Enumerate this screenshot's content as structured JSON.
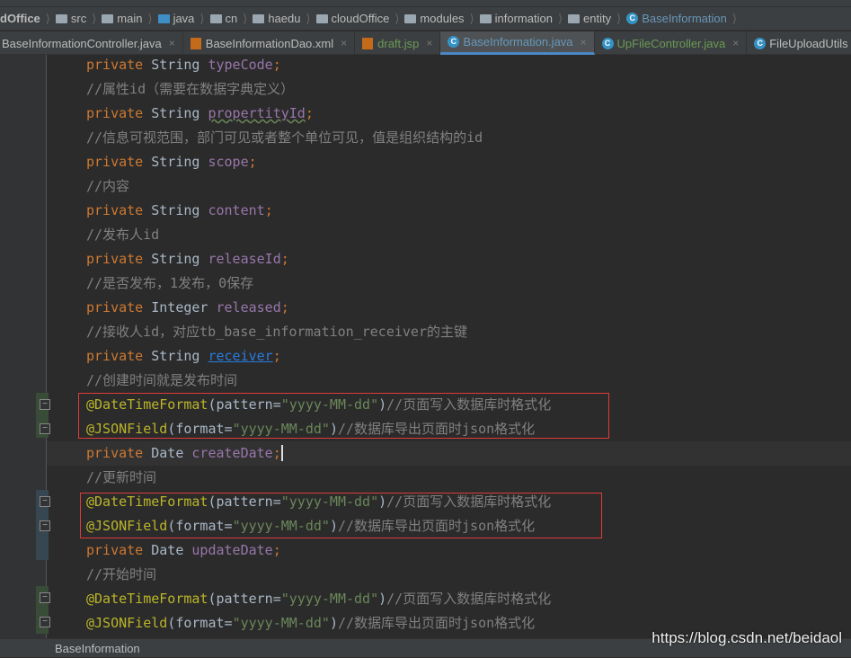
{
  "breadcrumb": [
    {
      "label": "dOffice",
      "icon": "none"
    },
    {
      "label": "src",
      "icon": "folder"
    },
    {
      "label": "main",
      "icon": "folder"
    },
    {
      "label": "java",
      "icon": "folder-blue"
    },
    {
      "label": "cn",
      "icon": "package"
    },
    {
      "label": "haedu",
      "icon": "package"
    },
    {
      "label": "cloudOffice",
      "icon": "package"
    },
    {
      "label": "modules",
      "icon": "package"
    },
    {
      "label": "information",
      "icon": "package"
    },
    {
      "label": "entity",
      "icon": "package"
    },
    {
      "label": "BaseInformation",
      "icon": "class"
    }
  ],
  "tabs": [
    {
      "label": "BaseInformationController.java",
      "icon": "none",
      "color": "#bbbbbb"
    },
    {
      "label": "BaseInformationDao.xml",
      "icon": "xml",
      "color": "#bbbbbb"
    },
    {
      "label": "draft.jsp",
      "icon": "jsp",
      "color": "#6a9955"
    },
    {
      "label": "BaseInformation.java",
      "icon": "class",
      "active": true,
      "color": "#6897bb"
    },
    {
      "label": "UpFileController.java",
      "icon": "class",
      "color": "#6a9955"
    },
    {
      "label": "FileUploadUtils",
      "icon": "class",
      "color": "#bbbbbb"
    }
  ],
  "code": [
    [
      [
        "kw",
        "private "
      ],
      [
        "ty",
        "String "
      ],
      [
        "fd",
        "typeCode"
      ],
      [
        "kw",
        ";"
      ]
    ],
    [
      [
        "cm",
        "//属性id（需要在数据字典定义）"
      ]
    ],
    [
      [
        "kw",
        "private "
      ],
      [
        "ty",
        "String "
      ],
      [
        "fd wavy",
        "propertityId"
      ],
      [
        "kw",
        ";"
      ]
    ],
    [
      [
        "cm",
        "//信息可视范围，部门可见或者整个单位可见，值是组织结构的id"
      ]
    ],
    [
      [
        "kw",
        "private "
      ],
      [
        "ty",
        "String "
      ],
      [
        "fd",
        "scope"
      ],
      [
        "kw",
        ";"
      ]
    ],
    [
      [
        "cm",
        "//内容"
      ]
    ],
    [
      [
        "kw",
        "private "
      ],
      [
        "ty",
        "String "
      ],
      [
        "fd",
        "content"
      ],
      [
        "kw",
        ";"
      ]
    ],
    [
      [
        "cm",
        "//发布人id"
      ]
    ],
    [
      [
        "kw",
        "private "
      ],
      [
        "ty",
        "String "
      ],
      [
        "fd",
        "releaseId"
      ],
      [
        "kw",
        ";"
      ]
    ],
    [
      [
        "cm",
        "//是否发布，1发布，0保存"
      ]
    ],
    [
      [
        "kw",
        "private "
      ],
      [
        "ty",
        "Integer "
      ],
      [
        "fd",
        "released"
      ],
      [
        "kw",
        ";"
      ]
    ],
    [
      [
        "cm",
        "//接收人id，对应tb_base_information_receiver的主键"
      ]
    ],
    [
      [
        "kw",
        "private "
      ],
      [
        "ty",
        "String "
      ],
      [
        "fd link",
        "receiver"
      ],
      [
        "kw",
        ";"
      ]
    ],
    [
      [
        "cm",
        "//创建时间就是发布时间"
      ]
    ],
    [
      [
        "an",
        "@DateTimeFormat"
      ],
      [
        "pl",
        "(pattern="
      ],
      [
        "st",
        "\"yyyy-MM-dd\""
      ],
      [
        "pl",
        ")"
      ],
      [
        "cm",
        "//页面写入数据库时格式化"
      ]
    ],
    [
      [
        "an",
        "@JSONField"
      ],
      [
        "pl",
        "(format="
      ],
      [
        "st",
        "\"yyyy-MM-dd\""
      ],
      [
        "pl",
        ")"
      ],
      [
        "cm",
        "//数据库导出页面时json格式化"
      ]
    ],
    [
      [
        "kw",
        "private "
      ],
      [
        "ty",
        "Date "
      ],
      [
        "fd",
        "createDate"
      ],
      [
        "kw caret",
        ";"
      ]
    ],
    [
      [
        "cm",
        "//更新时间"
      ]
    ],
    [
      [
        "an",
        "@DateTimeFormat"
      ],
      [
        "pl",
        "(pattern="
      ],
      [
        "st",
        "\"yyyy-MM-dd\""
      ],
      [
        "pl",
        ")"
      ],
      [
        "cm",
        "//页面写入数据库时格式化"
      ]
    ],
    [
      [
        "an",
        "@JSONField"
      ],
      [
        "pl",
        "(format="
      ],
      [
        "st",
        "\"yyyy-MM-dd\""
      ],
      [
        "pl",
        ")"
      ],
      [
        "cm",
        "//数据库导出页面时json格式化"
      ]
    ],
    [
      [
        "kw",
        "private "
      ],
      [
        "ty",
        "Date "
      ],
      [
        "fd",
        "updateDate"
      ],
      [
        "kw",
        ";"
      ]
    ],
    [
      [
        "cm",
        "//开始时间"
      ]
    ],
    [
      [
        "an",
        "@DateTimeFormat"
      ],
      [
        "pl",
        "(pattern="
      ],
      [
        "st",
        "\"yyyy-MM-dd\""
      ],
      [
        "pl",
        ")"
      ],
      [
        "cm",
        "//页面写入数据库时格式化"
      ]
    ],
    [
      [
        "an",
        "@JSONField"
      ],
      [
        "pl",
        "(format="
      ],
      [
        "st",
        "\"yyyy-MM-dd\""
      ],
      [
        "pl",
        ")"
      ],
      [
        "cm",
        "//数据库导出页面时json格式化"
      ]
    ]
  ],
  "current_line": 16,
  "status": {
    "label": "BaseInformation"
  },
  "watermark": "https://blog.csdn.net/beidaol"
}
